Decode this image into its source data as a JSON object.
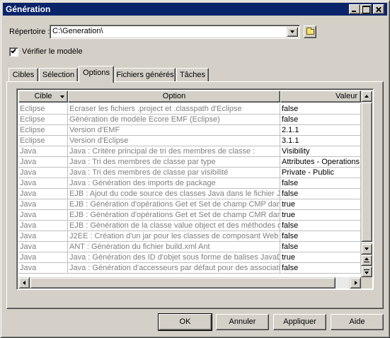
{
  "window": {
    "title": "Génération"
  },
  "directory": {
    "label": "Répertoire :",
    "value": "C:\\Generation\\"
  },
  "verify": {
    "label": "Vérifier le modèle",
    "checked": true
  },
  "tabs": [
    {
      "label": "Cibles",
      "active": false
    },
    {
      "label": "Sélection",
      "active": false
    },
    {
      "label": "Options",
      "active": true
    },
    {
      "label": "Fichiers générés",
      "active": false
    },
    {
      "label": "Tâches",
      "active": false
    }
  ],
  "table": {
    "columns": [
      "Cible",
      "Option",
      "Valeur"
    ],
    "rows": [
      {
        "cible": "Eclipse",
        "option": "Ecraser les fichiers .project et .classpath d'Eclipse",
        "valeur": "false"
      },
      {
        "cible": "Eclipse",
        "option": "Génération de modèle Ecore EMF (Eclipse)",
        "valeur": "false"
      },
      {
        "cible": "Eclipse",
        "option": "Version d'EMF",
        "valeur": "2.1.1"
      },
      {
        "cible": "Eclipse",
        "option": "Version d'Eclipse",
        "valeur": "3.1.1"
      },
      {
        "cible": "Java",
        "option": "Java : Critère principal de tri des membres de classe :",
        "valeur": "Visibility"
      },
      {
        "cible": "Java",
        "option": "Java : Tri des membres de classe par type",
        "valeur": "Attributes - Operations"
      },
      {
        "cible": "Java",
        "option": "Java : Tri des membres de classe par visibilité",
        "valeur": "Private - Public"
      },
      {
        "cible": "Java",
        "option": "Java : Génération des imports de package",
        "valeur": "false"
      },
      {
        "cible": "Java",
        "option": "EJB : Ajout du code source des classes Java dans le fichier JA",
        "valeur": "false"
      },
      {
        "cible": "Java",
        "option": "EJB : Génération d'opérations Get et Set de champ CMP dans",
        "valeur": "true"
      },
      {
        "cible": "Java",
        "option": "EJB : Génération d'opérations Get et Set de champ CMR dans",
        "valeur": "true"
      },
      {
        "cible": "Java",
        "option": "EJB : Génération de la classe value object et des méthodes de",
        "valeur": "false"
      },
      {
        "cible": "Java",
        "option": "J2EE : Création d'un jar pour les classes de composant Web",
        "valeur": "false"
      },
      {
        "cible": "Java",
        "option": "ANT : Génération du fichier build.xml Ant",
        "valeur": "false"
      },
      {
        "cible": "Java",
        "option": "Java : Génération des ID d'objet sous forme de balises JavaDo",
        "valeur": "true"
      },
      {
        "cible": "Java",
        "option": "Java : Génération d'accesseurs par défaut pour des associatio",
        "valeur": "false"
      }
    ]
  },
  "buttons": {
    "ok": "OK",
    "cancel": "Annuler",
    "apply": "Appliquer",
    "help": "Aide"
  },
  "colors": {
    "titlebar": "#0a246a",
    "face": "#d4d0c8",
    "dim_text": "#808080"
  }
}
